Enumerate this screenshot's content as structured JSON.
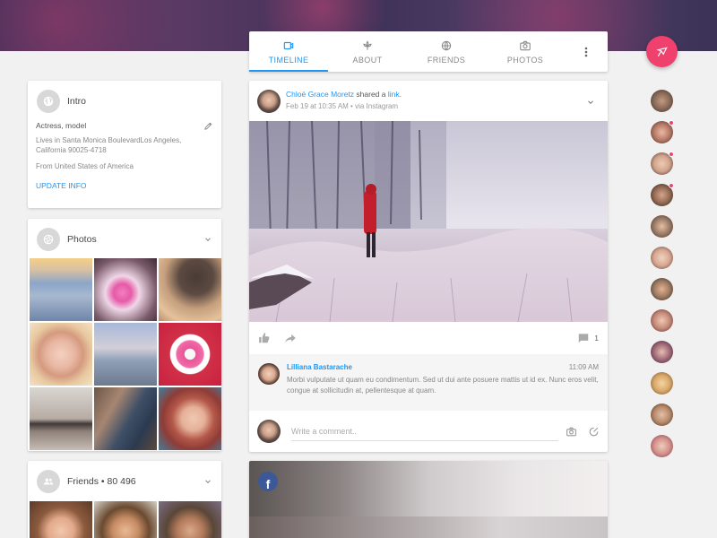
{
  "tabs": [
    {
      "label": "TIMELINE",
      "icon": "timeline-icon",
      "active": true
    },
    {
      "label": "ABOUT",
      "icon": "about-icon",
      "active": false
    },
    {
      "label": "FRIENDS",
      "icon": "friends-icon",
      "active": false
    },
    {
      "label": "PHOTOS",
      "icon": "camera-icon",
      "active": false
    }
  ],
  "intro": {
    "title": "Intro",
    "role": "Actress, model",
    "lives": "Lives in Santa Monica BoulevardLos Angeles, California 90025-4718",
    "from": "From United States of America",
    "update_label": "UPDATE INFO"
  },
  "photos": {
    "title": "Photos"
  },
  "friends": {
    "title": "Friends • 80 496"
  },
  "post": {
    "author": "Chloë Grace Moretz",
    "action": " shared a ",
    "link": "link",
    "link_suffix": ".",
    "meta": "Feb 19 at 10:35 AM • via Instagram",
    "comment_count": "1"
  },
  "comment": {
    "name": "Lilliana Bastarache",
    "time": "11:09 AM",
    "text": "Morbi vulputate ut quam eu condimentum. Sed ut dui ante posuere mattis ut id ex. Nunc eros velit, congue at sollicitudin at, pellentesque at quam."
  },
  "write": {
    "placeholder": "Write a comment.."
  },
  "colors": {
    "accent": "#2196f3",
    "fab": "#f0406e",
    "facebook": "#3b5998"
  }
}
